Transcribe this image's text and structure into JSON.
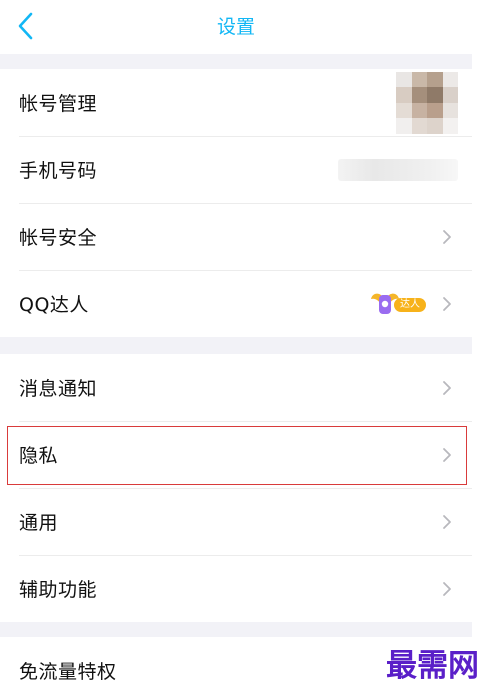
{
  "header": {
    "title": "设置"
  },
  "icons": {
    "back": "chevron-left-icon",
    "row_arrow": "chevron-right-icon",
    "daren": "qq-daren-wing-badge-icon"
  },
  "colors": {
    "accent": "#12b7f5",
    "highlight_border": "#d93b3b",
    "badge": "#f7b21a",
    "watermark": "#5a1fc8"
  },
  "groups": [
    {
      "items": [
        {
          "label": "帐号管理"
        },
        {
          "label": "手机号码"
        },
        {
          "label": "帐号安全"
        },
        {
          "label": "QQ达人",
          "badge_text": "达人"
        }
      ]
    },
    {
      "items": [
        {
          "label": "消息通知"
        },
        {
          "label": "隐私",
          "highlighted": true
        },
        {
          "label": "通用"
        },
        {
          "label": "辅助功能"
        }
      ]
    },
    {
      "items": [
        {
          "label": "免流量特权"
        }
      ]
    }
  ],
  "watermark": "最需网"
}
